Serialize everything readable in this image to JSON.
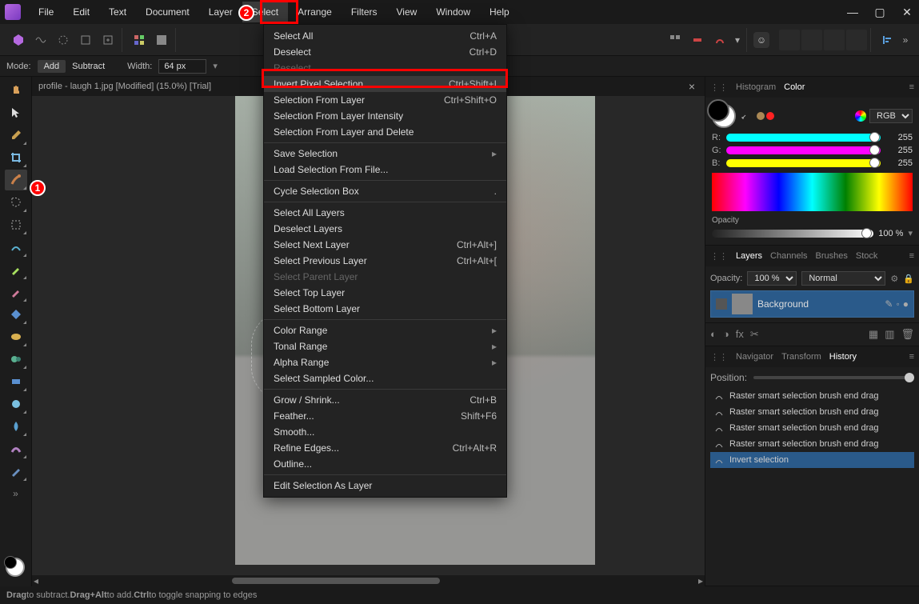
{
  "menubar": [
    "File",
    "Edit",
    "Text",
    "Document",
    "Layer",
    "Select",
    "Arrange",
    "Filters",
    "View",
    "Window",
    "Help"
  ],
  "menubar_selected_index": 5,
  "context": {
    "mode_label": "Mode:",
    "add": "Add",
    "subtract": "Subtract",
    "width_label": "Width:",
    "width_value": "64 px"
  },
  "doc_tab": "profile - laugh 1.jpg [Modified] (15.0%) [Trial]",
  "dropdown": {
    "groups": [
      [
        {
          "label": "Select All",
          "shortcut": "Ctrl+A"
        },
        {
          "label": "Deselect",
          "shortcut": "Ctrl+D"
        },
        {
          "label": "Reselect",
          "shortcut": "",
          "disabled": true
        },
        {
          "label": "Invert Pixel Selection",
          "shortcut": "Ctrl+Shift+I",
          "hover": true,
          "highlighted": true
        },
        {
          "label": "Selection From Layer",
          "shortcut": "Ctrl+Shift+O"
        },
        {
          "label": "Selection From Layer Intensity",
          "shortcut": ""
        },
        {
          "label": "Selection From Layer and Delete",
          "shortcut": ""
        }
      ],
      [
        {
          "label": "Save Selection",
          "submenu": true
        },
        {
          "label": "Load Selection From File...",
          "shortcut": ""
        }
      ],
      [
        {
          "label": "Cycle Selection Box",
          "shortcut": "."
        }
      ],
      [
        {
          "label": "Select All Layers",
          "shortcut": ""
        },
        {
          "label": "Deselect Layers",
          "shortcut": ""
        },
        {
          "label": "Select Next Layer",
          "shortcut": "Ctrl+Alt+]"
        },
        {
          "label": "Select Previous Layer",
          "shortcut": "Ctrl+Alt+["
        },
        {
          "label": "Select Parent Layer",
          "shortcut": "",
          "disabled": true
        },
        {
          "label": "Select Top Layer",
          "shortcut": ""
        },
        {
          "label": "Select Bottom Layer",
          "shortcut": ""
        }
      ],
      [
        {
          "label": "Color Range",
          "submenu": true
        },
        {
          "label": "Tonal Range",
          "submenu": true
        },
        {
          "label": "Alpha Range",
          "submenu": true
        },
        {
          "label": "Select Sampled Color...",
          "shortcut": ""
        }
      ],
      [
        {
          "label": "Grow / Shrink...",
          "shortcut": "Ctrl+B"
        },
        {
          "label": "Feather...",
          "shortcut": "Shift+F6"
        },
        {
          "label": "Smooth...",
          "shortcut": ""
        },
        {
          "label": "Refine Edges...",
          "shortcut": "Ctrl+Alt+R"
        },
        {
          "label": "Outline...",
          "shortcut": ""
        }
      ],
      [
        {
          "label": "Edit Selection As Layer",
          "shortcut": ""
        }
      ]
    ]
  },
  "panels": {
    "color": {
      "tabs": [
        "Histogram",
        "Color"
      ],
      "active": 1,
      "mode": "RGB",
      "r": 255,
      "g": 255,
      "b": 255,
      "opacity_label": "Opacity",
      "opacity": "100 %"
    },
    "layers": {
      "tabs": [
        "Layers",
        "Channels",
        "Brushes",
        "Stock"
      ],
      "active": 0,
      "opacity_label": "Opacity:",
      "opacity": "100 %",
      "blend": "Normal",
      "layer_name": "Background"
    },
    "history": {
      "tabs": [
        "Navigator",
        "Transform",
        "History"
      ],
      "active": 2,
      "position_label": "Position:",
      "items": [
        "Raster smart selection brush end drag",
        "Raster smart selection brush end drag",
        "Raster smart selection brush end drag",
        "Raster smart selection brush end drag",
        "Invert selection"
      ],
      "selected_index": 4
    }
  },
  "statusbar": {
    "drag": "Drag",
    "drag_rest": " to subtract. ",
    "dragalt": "Drag+Alt",
    "dragalt_rest": " to add. ",
    "ctrl": "Ctrl",
    "ctrl_rest": " to toggle snapping to edges"
  },
  "tool_names": [
    "hand",
    "arrow",
    "color-picker",
    "crop",
    "selection-brush",
    "freehand-selection",
    "marquee",
    "flood-select",
    "paint-brush",
    "erase",
    "fill",
    "sponge",
    "clone",
    "inpaint",
    "dodge",
    "blur",
    "smudge",
    "pen",
    "more"
  ],
  "markers": {
    "one": "1",
    "two": "2"
  }
}
